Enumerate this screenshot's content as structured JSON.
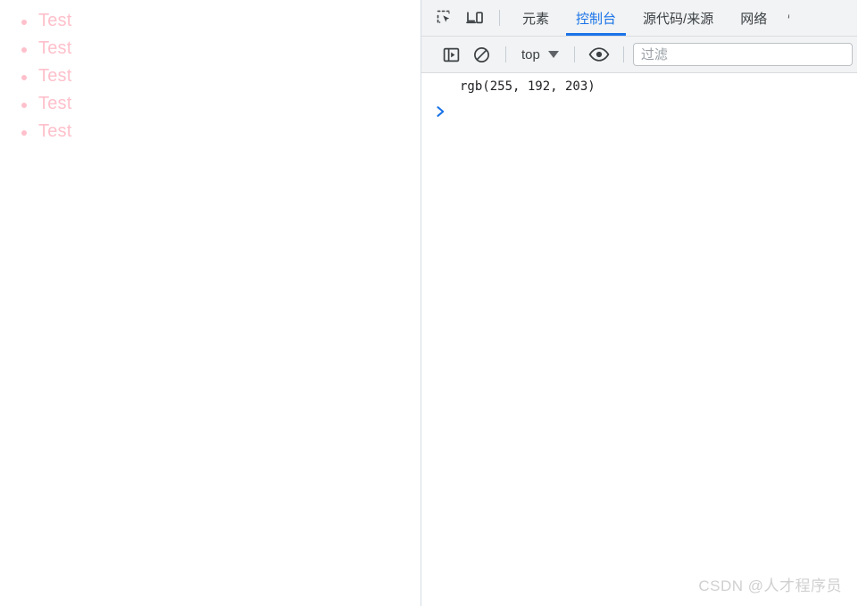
{
  "page": {
    "list_items": [
      "Test",
      "Test",
      "Test",
      "Test",
      "Test"
    ],
    "text_color": "#ffc0cb"
  },
  "devtools": {
    "tabs": [
      {
        "label": "元素",
        "active": false
      },
      {
        "label": "控制台",
        "active": true
      },
      {
        "label": "源代码/来源",
        "active": false
      },
      {
        "label": "网络",
        "active": false
      }
    ],
    "active_tab_color": "#1a73e8",
    "toolbar": {
      "context_label": "top",
      "filter_placeholder": "过滤"
    },
    "console": {
      "messages": [
        {
          "text": "rgb(255, 192, 203)"
        }
      ],
      "prompt_symbol": ">"
    }
  },
  "watermark": {
    "text": "CSDN @人才程序员"
  }
}
